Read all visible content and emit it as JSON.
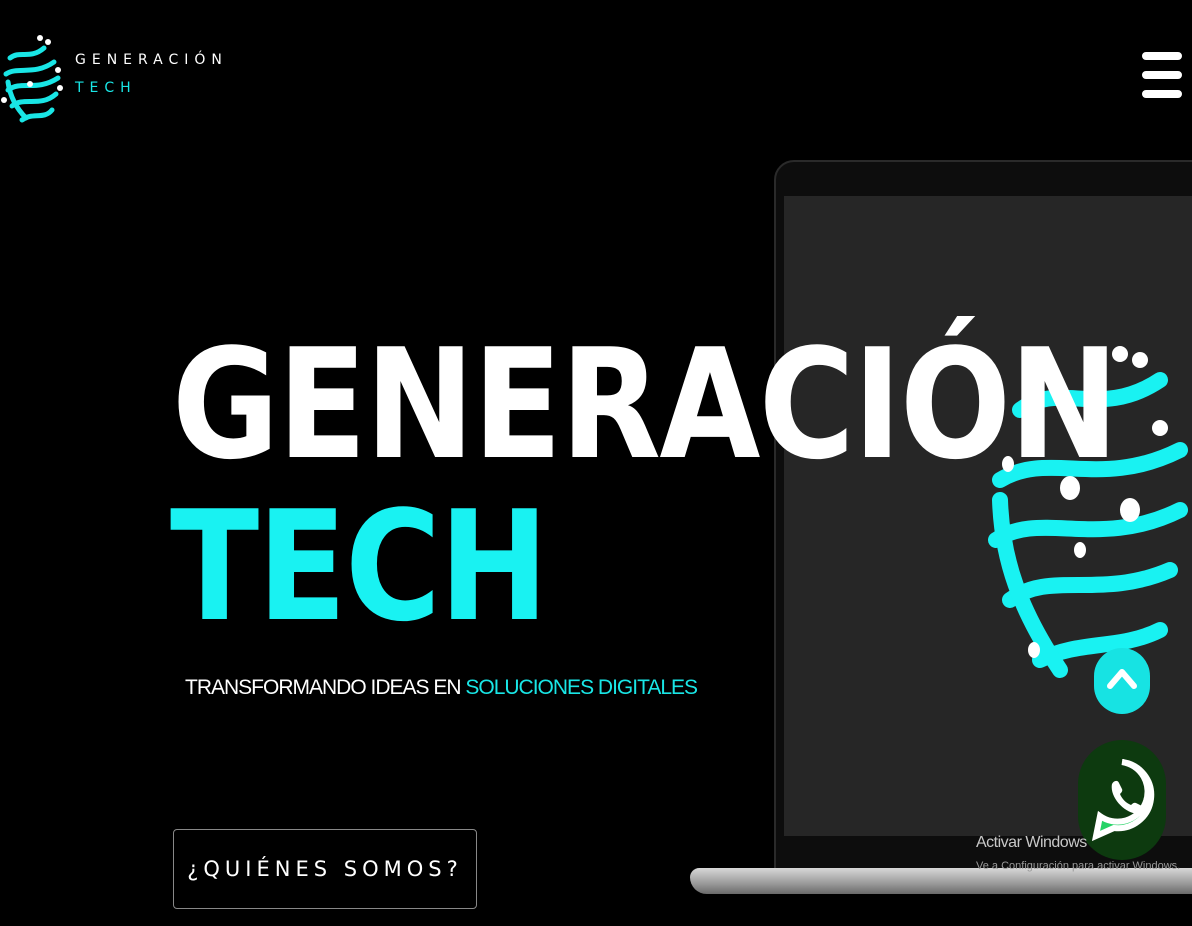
{
  "header": {
    "logo_word1": "GENERACIÓN",
    "logo_word2": "TECH",
    "menu_icon": "hamburger-menu-icon"
  },
  "hero": {
    "title_line1": "GENERACIÓN",
    "title_line2": "TECH",
    "tagline_part1": "TRANSFORMANDO IDEAS EN ",
    "tagline_part2": "SOLUCIONES DIGITALES",
    "cta_label": "¿QUIÉNES SOMOS?"
  },
  "floating": {
    "scroll_top_icon": "chevron-up-icon",
    "whatsapp_icon": "whatsapp-icon"
  },
  "windows_watermark": {
    "line1": "Activar Windows",
    "line2": "Ve a Configuración para activar Windows."
  },
  "colors": {
    "background": "#000000",
    "accent": "#19e6e6",
    "text": "#ffffff",
    "whatsapp_green": "#25d366"
  }
}
